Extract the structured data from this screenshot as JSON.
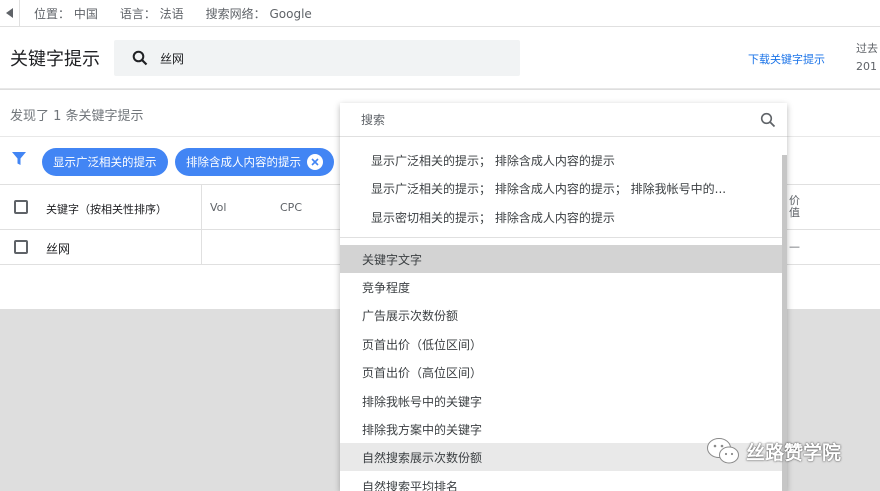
{
  "location_bar": {
    "location": "位置： 中国",
    "language": "语言： 法语",
    "network": "搜索网络： Google"
  },
  "header": {
    "title": "关键字提示",
    "search_value": "丝网",
    "download_link": "下载关键字提示",
    "right_partial": [
      "过去",
      "201"
    ]
  },
  "main": {
    "found_text": "发现了 1 条关键字提示",
    "chips": [
      {
        "label": "显示广泛相关的提示"
      },
      {
        "label": "排除含成人内容的提示"
      }
    ],
    "table": {
      "headers": [
        "关键字（按相关性排序）",
        "Vol",
        "CPC"
      ],
      "rows": [
        {
          "keyword": "丝网"
        }
      ],
      "right_partial": [
        "价",
        "值",
        "—"
      ]
    }
  },
  "dropdown": {
    "search_placeholder": "搜索",
    "suggestions": [
      "显示广泛相关的提示； 排除含成人内容的提示",
      "显示广泛相关的提示； 排除含成人内容的提示； 排除我帐号中的...",
      "显示密切相关的提示； 排除含成人内容的提示"
    ],
    "columns": [
      "关键字文字",
      "竞争程度",
      "广告展示次数份额",
      "页首出价（低位区间）",
      "页首出价（高位区间）",
      "排除我帐号中的关键字",
      "排除我方案中的关键字",
      "自然搜索展示次数份额",
      "自然搜索平均排名"
    ]
  },
  "watermark": "丝路赞学院",
  "colors": {
    "accent": "#4285f4",
    "link": "#1a73e8"
  }
}
